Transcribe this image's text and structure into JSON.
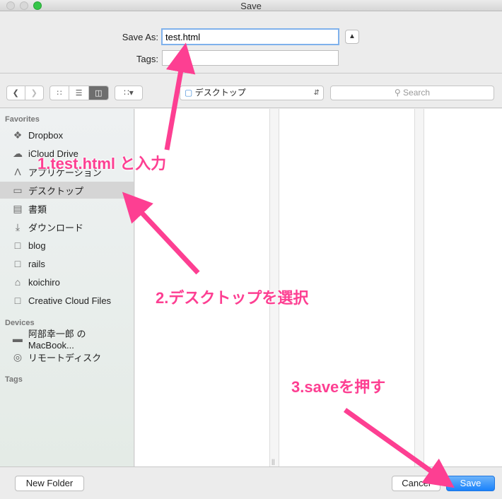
{
  "window": {
    "title": "Save"
  },
  "form": {
    "save_as_label": "Save As:",
    "save_as_value": "test.html",
    "tags_label": "Tags:",
    "tags_value": ""
  },
  "toolbar": {
    "location": "デスクトップ",
    "search_placeholder": "Search"
  },
  "sidebar": {
    "favorites_header": "Favorites",
    "favorites": [
      {
        "label": "Dropbox",
        "icon": "dropbox-icon"
      },
      {
        "label": "iCloud Drive",
        "icon": "cloud-icon"
      },
      {
        "label": "アプリケーション",
        "icon": "applications-icon"
      },
      {
        "label": "デスクトップ",
        "icon": "desktop-icon",
        "selected": true
      },
      {
        "label": "書類",
        "icon": "document-icon"
      },
      {
        "label": "ダウンロード",
        "icon": "download-icon"
      },
      {
        "label": "blog",
        "icon": "folder-icon"
      },
      {
        "label": "rails",
        "icon": "folder-icon"
      },
      {
        "label": "koichiro",
        "icon": "home-icon"
      },
      {
        "label": "Creative Cloud Files",
        "icon": "folder-icon"
      }
    ],
    "devices_header": "Devices",
    "devices": [
      {
        "label": "阿部幸一郎 の MacBook...",
        "icon": "laptop-icon"
      },
      {
        "label": "リモートディスク",
        "icon": "disc-icon"
      }
    ],
    "tags_header": "Tags"
  },
  "footer": {
    "new_folder": "New Folder",
    "cancel": "Cancel",
    "save": "Save"
  },
  "annotations": {
    "step1": "1.test.html と入力",
    "step2": "2.デスクトップを選択",
    "step3": "3.saveを押す"
  },
  "colors": {
    "annotation": "#fd3f92",
    "primary_button": "#1a82fb",
    "selection": "#d5d5d5"
  }
}
